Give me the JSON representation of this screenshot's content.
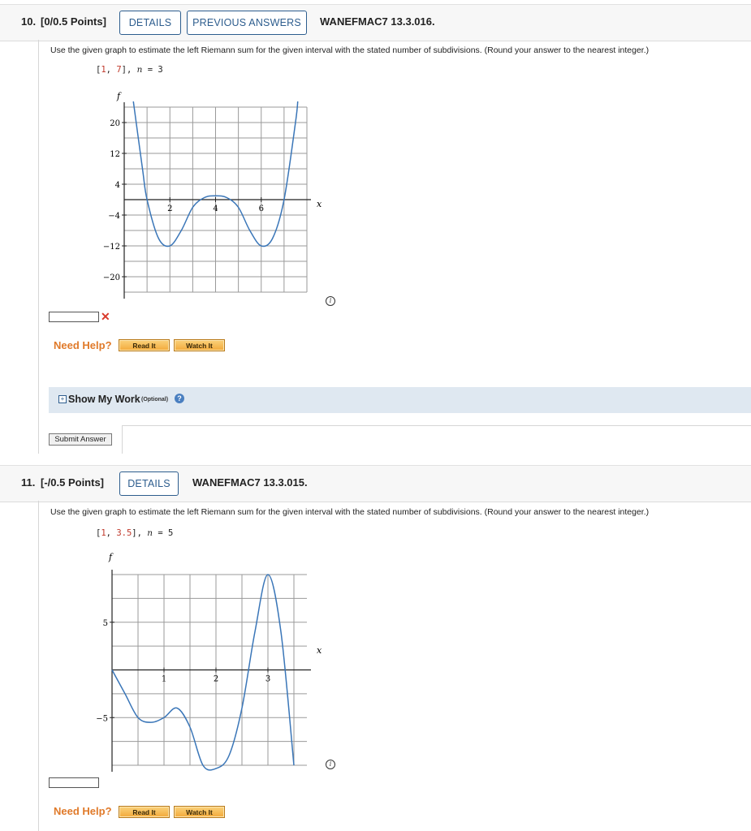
{
  "q10": {
    "number": "10.",
    "points": "[0/0.5 Points]",
    "details_label": "DETAILS",
    "previous_answers_label": "PREVIOUS ANSWERS",
    "code": "WANEFMAC7 13.3.016.",
    "prompt": "Use the given graph to estimate the left Riemann sum for the given interval with the stated number of subdivisions. (Round your answer to the nearest integer.)",
    "interval_open": "[",
    "interval_a": "1",
    "interval_sep": ", ",
    "interval_b": "7",
    "interval_close": "],",
    "n_label": "n",
    "n_value": " = 3",
    "need_help": "Need Help?",
    "read_it": "Read It",
    "watch_it": "Watch It",
    "show_my_work": "Show My Work",
    "optional": "(Optional)",
    "submit_label": "Submit Answer",
    "answer_value": "",
    "answer_status": "incorrect"
  },
  "q11": {
    "number": "11.",
    "points": "[-/0.5 Points]",
    "details_label": "DETAILS",
    "code": "WANEFMAC7 13.3.015.",
    "prompt": "Use the given graph to estimate the left Riemann sum for the given interval with the stated number of subdivisions. (Round your answer to the nearest integer.)",
    "interval_open": "[",
    "interval_a": "1",
    "interval_sep": ", ",
    "interval_b": "3.5",
    "interval_close": "],",
    "n_label": "n",
    "n_value": " = 5",
    "need_help": "Need Help?",
    "read_it": "Read It",
    "watch_it": "Watch It",
    "answer_value": ""
  },
  "icons": {
    "expand": "plus-square-icon",
    "help": "question-circle-icon",
    "info": "info-circle-icon",
    "incorrect": "x-mark-icon"
  },
  "colors": {
    "curve": "#3a76b8",
    "button_border": "#2d5d8e",
    "need_help": "#e07a2a",
    "incorrect": "#d9392b",
    "interval_values": "#c0392b"
  },
  "chart_data": [
    {
      "type": "line",
      "ylabel": "f",
      "xlabel": "x",
      "x_ticks": [
        2,
        4,
        6
      ],
      "y_ticks": [
        20,
        12,
        4,
        -4,
        -12,
        -20
      ],
      "xlim": [
        0,
        8
      ],
      "ylim": [
        -24,
        24
      ],
      "grid": true,
      "series": [
        {
          "x": [
            0.4,
            0.8,
            1.0,
            1.5,
            2.0,
            2.5,
            3.0,
            3.5,
            4.0,
            4.5,
            5.0,
            5.5,
            6.0,
            6.5,
            7.0,
            7.5,
            7.6
          ],
          "y": [
            30,
            8,
            0,
            -10,
            -12,
            -8,
            -2,
            0.5,
            1,
            0.5,
            -2,
            -8,
            -12,
            -10,
            0,
            20,
            30
          ]
        }
      ]
    },
    {
      "type": "line",
      "ylabel": "f",
      "xlabel": "x",
      "x_ticks": [
        1,
        2,
        3
      ],
      "y_ticks": [
        5,
        -5
      ],
      "xlim": [
        0,
        3.75
      ],
      "ylim": [
        -10,
        10
      ],
      "grid": true,
      "series": [
        {
          "x": [
            0,
            0.25,
            0.5,
            0.75,
            1.0,
            1.25,
            1.5,
            1.75,
            2.0,
            2.25,
            2.5,
            2.75,
            3.0,
            3.25,
            3.5
          ],
          "y": [
            0,
            -2.5,
            -5,
            -5.5,
            -5,
            -4,
            -6,
            -10,
            -12,
            -9,
            -4,
            4,
            10,
            4,
            -10
          ]
        }
      ]
    }
  ]
}
